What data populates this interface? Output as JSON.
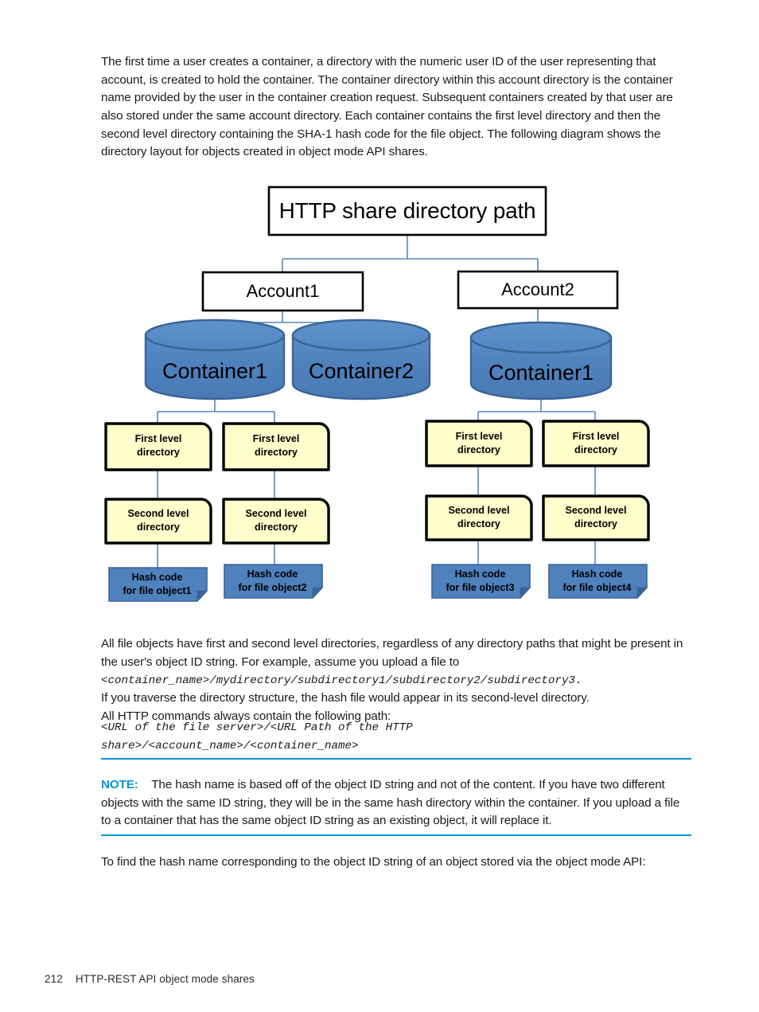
{
  "document": {
    "intro_paragraph": "The first time a user creates a container, a directory with the numeric user ID of the user representing that account, is created to hold the container. The container directory within this account directory is the container name provided by the user in the container creation request. Subsequent containers created by that user are also stored under the same account directory. Each container contains the first level directory and then the second level directory containing the SHA-1 hash code for the file object. The following diagram shows the directory layout for objects created in object mode API shares.",
    "after_diagram_paragraph_part1": "All file objects have first and second level directories, regardless of any directory paths that might be present in the user's object ID string. For example, assume you upload a file to ",
    "after_diagram_mono": "<container_name>/mydirectory/subdirectory1/subdirectory2/subdirectory3.",
    "after_diagram_paragraph_part2": "If you traverse the directory structure, the hash file would appear in its second-level directory.",
    "all_http_line": "All HTTP commands always contain the following path:",
    "url_path_line1": "<URL of the file server>/<URL Path of the HTTP",
    "url_path_line2": "share>/<account_name>/<container_name>",
    "note_label": "NOTE:",
    "note_text": "The hash name is based off of the object ID string and not of the content. If you have two different objects with the same ID string, they will be in the same hash directory within the container. If you upload a file to a container that has the same object ID string as an existing object, it will replace it.",
    "to_find_paragraph": "To find the hash name corresponding to the object ID string of an object stored via the object mode API:"
  },
  "footer": {
    "page_number": "212",
    "chapter_title": "HTTP-REST API object mode shares"
  },
  "diagram": {
    "root": {
      "label": "HTTP share directory path"
    },
    "accounts": [
      {
        "label": "Account1"
      },
      {
        "label": "Account2"
      }
    ],
    "containers": [
      {
        "label": "Container1"
      },
      {
        "label": "Container2"
      },
      {
        "label": "Container1"
      }
    ],
    "first_level": [
      {
        "line1": "First level",
        "line2": "directory"
      },
      {
        "line1": "First level",
        "line2": "directory"
      },
      {
        "line1": "First level",
        "line2": "directory"
      },
      {
        "line1": "First level",
        "line2": "directory"
      }
    ],
    "second_level": [
      {
        "line1": "Second level",
        "line2": "directory"
      },
      {
        "line1": "Second level",
        "line2": "directory"
      },
      {
        "line1": "Second level",
        "line2": "directory"
      },
      {
        "line1": "Second level",
        "line2": "directory"
      }
    ],
    "hash_codes": [
      {
        "line1": "Hash code",
        "line2": "for file object1"
      },
      {
        "line1": "Hash code",
        "line2": "for file object2"
      },
      {
        "line1": "Hash code",
        "line2": "for file object3"
      },
      {
        "line1": "Hash code",
        "line2": "for file object4"
      }
    ]
  },
  "colors": {
    "accent_blue": "#0096d6",
    "cylinder_fill": "#4f81bd",
    "cylinder_stroke": "#3a6496",
    "cylinder_top_fill": "#5b8fc9",
    "note_box_fill": "#ffffcc",
    "note_box_stroke": "#000000",
    "hash_box_fill": "#4f81bd",
    "hash_box_stroke": "#3a6496",
    "connector_line": "#5b87b5",
    "text_black": "#000000"
  }
}
